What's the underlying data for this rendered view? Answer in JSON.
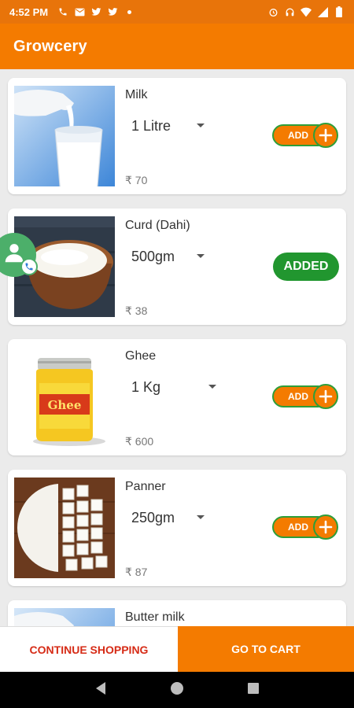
{
  "status_bar": {
    "time": "4:52 PM",
    "left_icons": [
      "phone-icon",
      "mail-icon",
      "twitter-icon",
      "twitter-icon",
      "dot-icon"
    ],
    "right_icons": [
      "alarm-icon",
      "headset-icon",
      "wifi-icon",
      "signal-icon",
      "battery-icon"
    ]
  },
  "app_bar": {
    "title": "Growcery"
  },
  "colors": {
    "primary": "#f47b00",
    "added": "#21962f",
    "continue_text": "#d62b16"
  },
  "products": [
    {
      "name": "Milk",
      "quantity": "1 Litre",
      "price": "₹ 70",
      "state": "add",
      "button_label": "ADD",
      "image": "milk-glass"
    },
    {
      "name": "Curd (Dahi)",
      "quantity": "500gm",
      "price": "₹ 38",
      "state": "added",
      "button_label": "ADDED",
      "image": "curd-bowl"
    },
    {
      "name": "Ghee",
      "quantity": "1 Kg",
      "price": "₹ 600",
      "state": "add",
      "button_label": "ADD",
      "image": "ghee-jar"
    },
    {
      "name": "Panner",
      "quantity": "250gm",
      "price": "₹ 87",
      "state": "add",
      "button_label": "ADD",
      "image": "paneer-cubes"
    },
    {
      "name": "Butter milk",
      "quantity": "",
      "price": "",
      "state": "add",
      "button_label": "",
      "image": "milk-glass"
    }
  ],
  "bottom_bar": {
    "continue_label": "CONTINUE SHOPPING",
    "cart_label": "GO TO CART"
  },
  "nav_bar": {
    "buttons": [
      "back-icon",
      "home-icon",
      "recents-icon"
    ]
  }
}
